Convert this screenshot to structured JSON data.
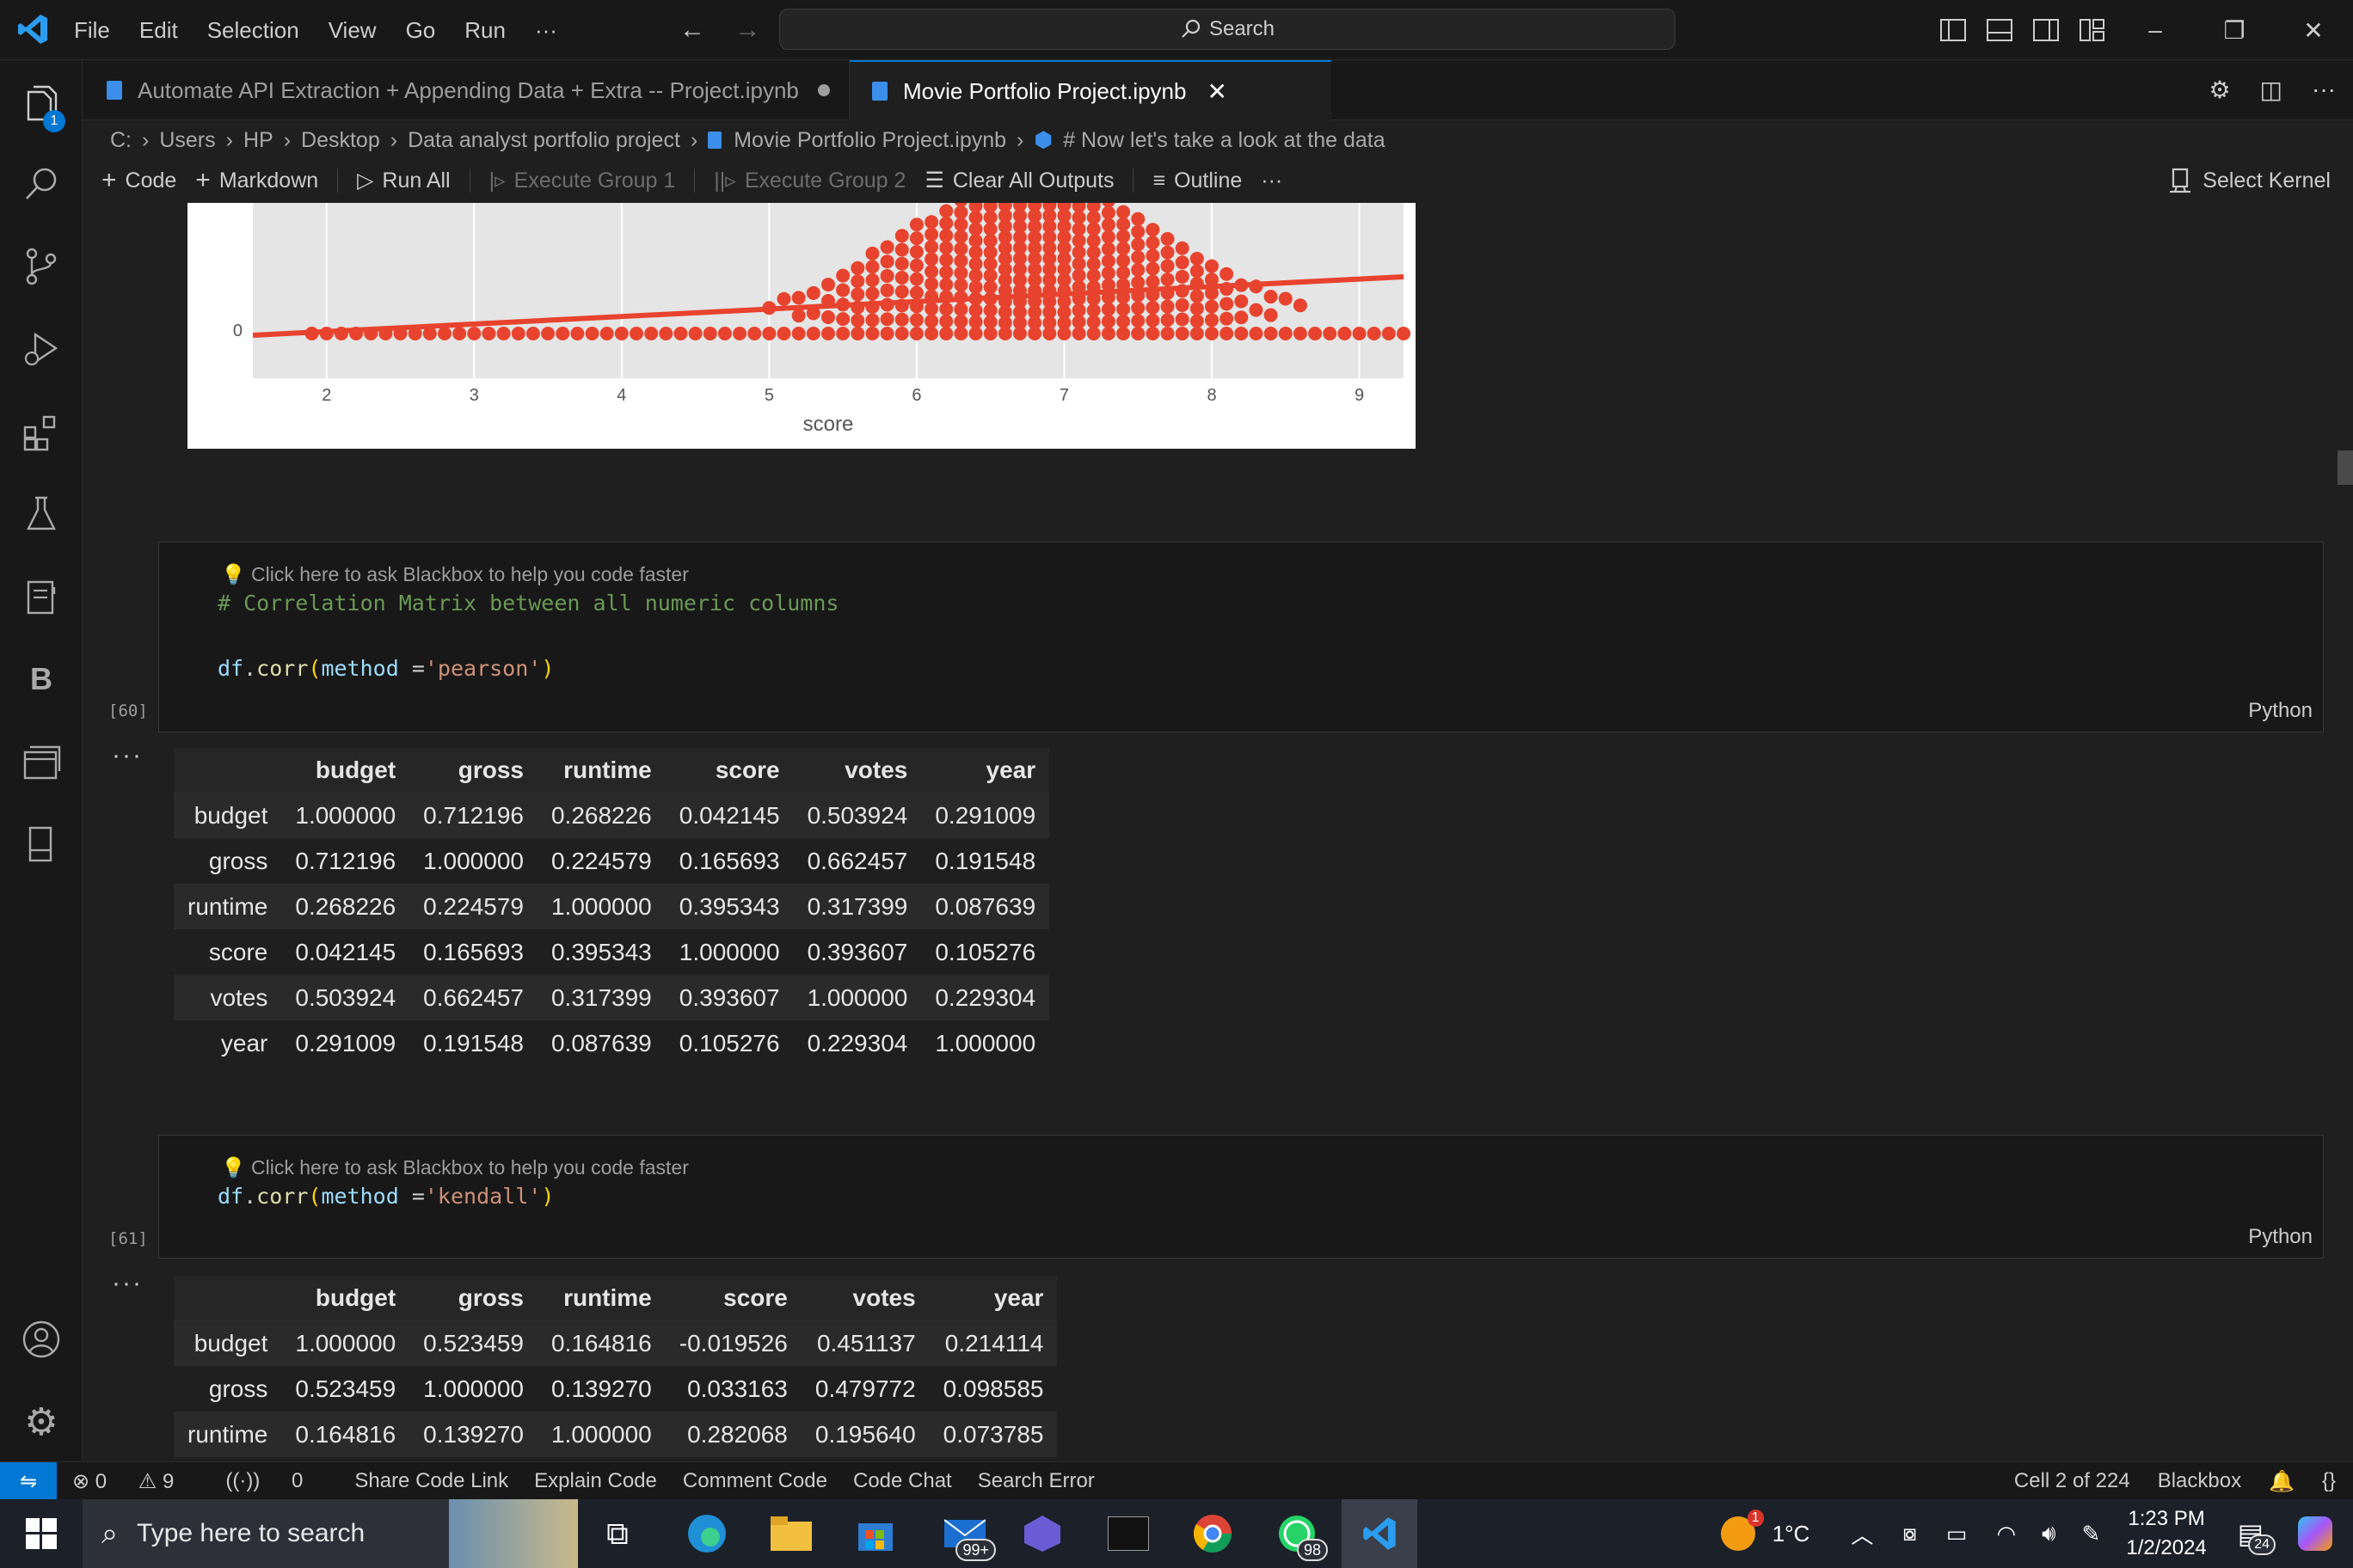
{
  "menu": [
    "File",
    "Edit",
    "Selection",
    "View",
    "Go",
    "Run",
    "···"
  ],
  "search": {
    "label": "Search"
  },
  "activity_badge": "1",
  "tabs": [
    {
      "label": "Automate API Extraction + Appending Data + Extra -- Project.ipynb",
      "modified": true
    },
    {
      "label": "Movie Portfolio Project.ipynb",
      "active": true
    }
  ],
  "breadcrumb": [
    "C:",
    "Users",
    "HP",
    "Desktop",
    "Data analyst portfolio project",
    "Movie Portfolio Project.ipynb",
    "# Now let's take a look at the data"
  ],
  "toolbar": {
    "code": "Code",
    "markdown": "Markdown",
    "run_all": "Run All",
    "exec1": "Execute Group 1",
    "exec2": "Execute Group 2",
    "clear": "Clear All Outputs",
    "outline": "Outline",
    "more": "···",
    "kernel": "Select Kernel"
  },
  "chart_data": {
    "type": "scatter",
    "xlabel": "score",
    "x_ticks": [
      "2",
      "3",
      "4",
      "5",
      "6",
      "7",
      "8",
      "9"
    ],
    "y_ticks": [
      "0"
    ],
    "xlim": [
      1.5,
      9.3
    ],
    "point_color": "#e8432e",
    "regression_color": "#e8432e"
  },
  "cells": [
    {
      "hint": "Click here to ask Blackbox to help you code faster",
      "comment": "# Correlation Matrix between all numeric columns",
      "code_obj": "df",
      "code_fn": "corr",
      "code_arg": "method",
      "code_str": "'pearson'",
      "exec": "[60]",
      "lang": "Python"
    },
    {
      "hint": "Click here to ask Blackbox to help you code faster",
      "code_obj": "df",
      "code_fn": "corr",
      "code_arg": "method",
      "code_str": "'kendall'",
      "exec": "[61]",
      "lang": "Python"
    }
  ],
  "output_more": "···",
  "pearson": {
    "columns": [
      "",
      "budget",
      "gross",
      "runtime",
      "score",
      "votes",
      "year"
    ],
    "rows": [
      [
        "budget",
        "1.000000",
        "0.712196",
        "0.268226",
        "0.042145",
        "0.503924",
        "0.291009"
      ],
      [
        "gross",
        "0.712196",
        "1.000000",
        "0.224579",
        "0.165693",
        "0.662457",
        "0.191548"
      ],
      [
        "runtime",
        "0.268226",
        "0.224579",
        "1.000000",
        "0.395343",
        "0.317399",
        "0.087639"
      ],
      [
        "score",
        "0.042145",
        "0.165693",
        "0.395343",
        "1.000000",
        "0.393607",
        "0.105276"
      ],
      [
        "votes",
        "0.503924",
        "0.662457",
        "0.317399",
        "0.393607",
        "1.000000",
        "0.229304"
      ],
      [
        "year",
        "0.291009",
        "0.191548",
        "0.087639",
        "0.105276",
        "0.229304",
        "1.000000"
      ]
    ]
  },
  "kendall": {
    "columns": [
      "",
      "budget",
      "gross",
      "runtime",
      "score",
      "votes",
      "year"
    ],
    "rows": [
      [
        "budget",
        "1.000000",
        "0.523459",
        "0.164816",
        "-0.019526",
        "0.451137",
        "0.214114"
      ],
      [
        "gross",
        "0.523459",
        "1.000000",
        "0.139270",
        "0.033163",
        "0.479772",
        "0.098585"
      ],
      [
        "runtime",
        "0.164816",
        "0.139270",
        "1.000000",
        "0.282068",
        "0.195640",
        "0.073785"
      ]
    ]
  },
  "status": {
    "errors": "0",
    "warnings": "9",
    "ports": "0",
    "items": [
      "Share Code Link",
      "Explain Code",
      "Comment Code",
      "Code Chat",
      "Search Error"
    ],
    "cell": "Cell 2 of 224",
    "ext": "Blackbox"
  },
  "taskbar": {
    "search_placeholder": "Type here to search",
    "mail_badge": "99+",
    "whatsapp_badge": "98",
    "weather_badge": "1",
    "temp": "1°C",
    "time": "1:23 PM",
    "date": "1/2/2024",
    "notif_badge": "24"
  }
}
